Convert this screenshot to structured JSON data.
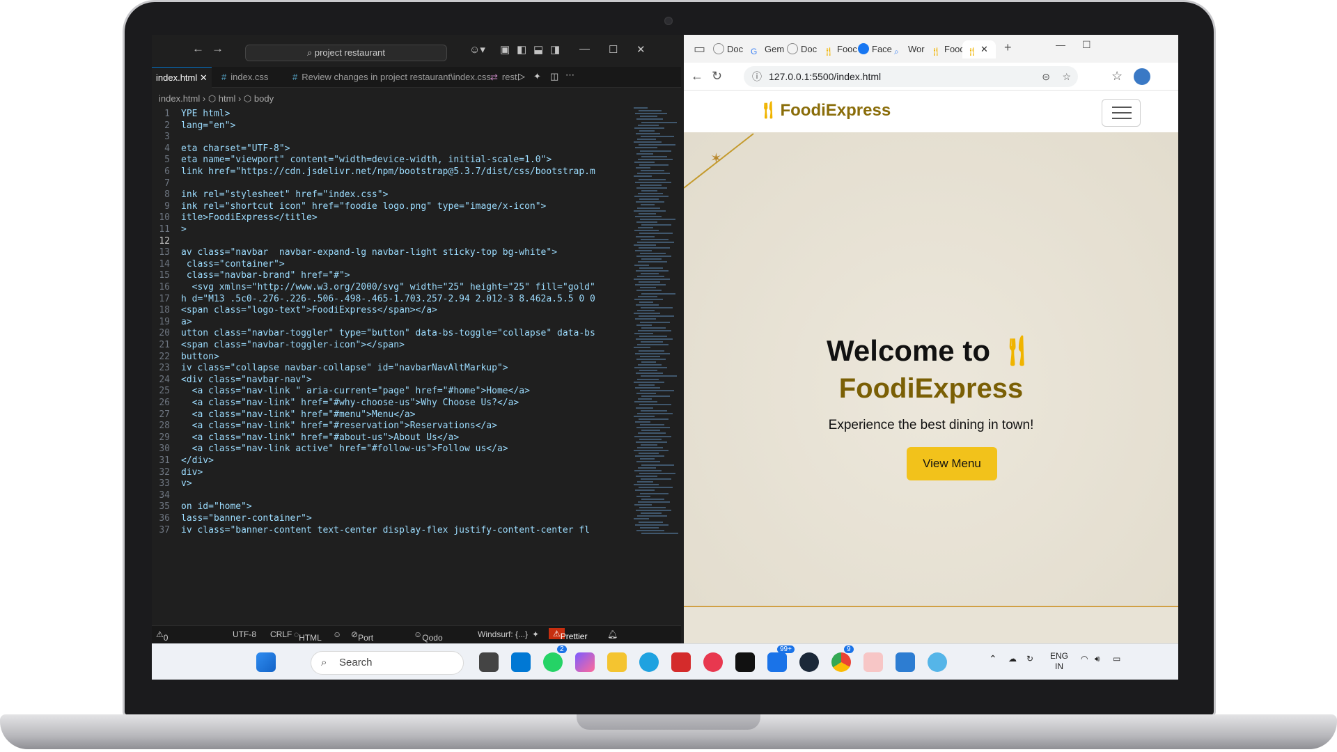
{
  "vscode": {
    "search": "project restaurant",
    "tabs": [
      {
        "label": "index.html"
      },
      {
        "label": "index.css"
      },
      {
        "label": "Review changes in project restaurant\\index.css"
      },
      {
        "label": "rest"
      }
    ],
    "breadcrumb": {
      "file": "index.html",
      "tag1": "html",
      "tag2": "body"
    },
    "lines": [
      {
        "n": "1",
        "code": "YPE html>"
      },
      {
        "n": "2",
        "code": "lang=\"en\">"
      },
      {
        "n": "3",
        "code": ""
      },
      {
        "n": "4",
        "code": "eta charset=\"UTF-8\">"
      },
      {
        "n": "5",
        "code": "eta name=\"viewport\" content=\"width=device-width, initial-scale=1.0\">"
      },
      {
        "n": "6",
        "code": "link href=\"https://cdn.jsdelivr.net/npm/bootstrap@5.3.7/dist/css/bootstrap.m"
      },
      {
        "n": "7",
        "code": ""
      },
      {
        "n": "8",
        "code": "ink rel=\"stylesheet\" href=\"index.css\">"
      },
      {
        "n": "9",
        "code": "ink rel=\"shortcut icon\" href=\"foodie logo.png\" type=\"image/x-icon\">"
      },
      {
        "n": "10",
        "code": "itle>FoodiExpress</title>"
      },
      {
        "n": "11",
        "code": ">"
      },
      {
        "n": "12",
        "code": ""
      },
      {
        "n": "13",
        "code": "av class=\"navbar  navbar-expand-lg navbar-light sticky-top bg-white\">"
      },
      {
        "n": "14",
        "code": " class=\"container\">"
      },
      {
        "n": "15",
        "code": " class=\"navbar-brand\" href=\"#\">"
      },
      {
        "n": "16",
        "code": "  <svg xmlns=\"http://www.w3.org/2000/svg\" width=\"25\" height=\"25\" fill=\"gold\""
      },
      {
        "n": "17",
        "code": "h d=\"M13 .5c0-.276-.226-.506-.498-.465-1.703.257-2.94 2.012-3 8.462a.5.5 0 0"
      },
      {
        "n": "18",
        "code": "<span class=\"logo-text\">FoodiExpress</span></a>"
      },
      {
        "n": "19",
        "code": "a>"
      },
      {
        "n": "20",
        "code": "utton class=\"navbar-toggler\" type=\"button\" data-bs-toggle=\"collapse\" data-bs"
      },
      {
        "n": "21",
        "code": "<span class=\"navbar-toggler-icon\"></span>"
      },
      {
        "n": "22",
        "code": "button>"
      },
      {
        "n": "23",
        "code": "iv class=\"collapse navbar-collapse\" id=\"navbarNavAltMarkup\">"
      },
      {
        "n": "24",
        "code": "<div class=\"navbar-nav\">"
      },
      {
        "n": "25",
        "code": "  <a class=\"nav-link \" aria-current=\"page\" href=\"#home\">Home</a>"
      },
      {
        "n": "26",
        "code": "  <a class=\"nav-link\" href=\"#why-choose-us\">Why Choose Us?</a>"
      },
      {
        "n": "27",
        "code": "  <a class=\"nav-link\" href=\"#menu\">Menu</a>"
      },
      {
        "n": "28",
        "code": "  <a class=\"nav-link\" href=\"#reservation\">Reservations</a>"
      },
      {
        "n": "29",
        "code": "  <a class=\"nav-link\" href=\"#about-us\">About Us</a>"
      },
      {
        "n": "30",
        "code": "  <a class=\"nav-link active\" href=\"#follow-us\">Follow us</a>"
      },
      {
        "n": "31",
        "code": "</div>"
      },
      {
        "n": "32",
        "code": "div>"
      },
      {
        "n": "33",
        "code": "v>"
      },
      {
        "n": "34",
        "code": ""
      },
      {
        "n": "35",
        "code": "on id=\"home\">"
      },
      {
        "n": "36",
        "code": "lass=\"banner-container\">"
      },
      {
        "n": "37",
        "code": "iv class=\"banner-content text-center display-flex justify-content-center fl"
      }
    ],
    "status": {
      "problems": "0",
      "encoding": "UTF-8",
      "eol": "CRLF",
      "language": "HTML",
      "port": "Port : 5500",
      "qodo": "Qodo Gen",
      "windsurf": "Windsurf: {...}",
      "prettier": "Prettier"
    }
  },
  "browser": {
    "tabs": [
      {
        "label": "Doc"
      },
      {
        "label": "Gem"
      },
      {
        "label": "Doc"
      },
      {
        "label": "Fooc"
      },
      {
        "label": "Face"
      },
      {
        "label": "Wor"
      },
      {
        "label": "Food"
      }
    ],
    "url": "127.0.0.1:5500/index.html",
    "page": {
      "brand": "FoodiExpress",
      "welcome": "Welcome to",
      "brand_big": "FoodiExpress",
      "tagline": "Experience the best dining in town!",
      "button": "View Menu"
    }
  },
  "taskbar": {
    "search": "Search",
    "whatsapp_badge": "2",
    "teams_badge": "99+",
    "chrome_badge": "9",
    "lang_top": "ENG",
    "lang_bottom": "IN"
  },
  "colors": {
    "brand_gold": "#8a6d0a",
    "button_yellow": "#f2c21b",
    "prettier_red": "#c72e0f",
    "vscode_bg": "#1f1f1f"
  }
}
